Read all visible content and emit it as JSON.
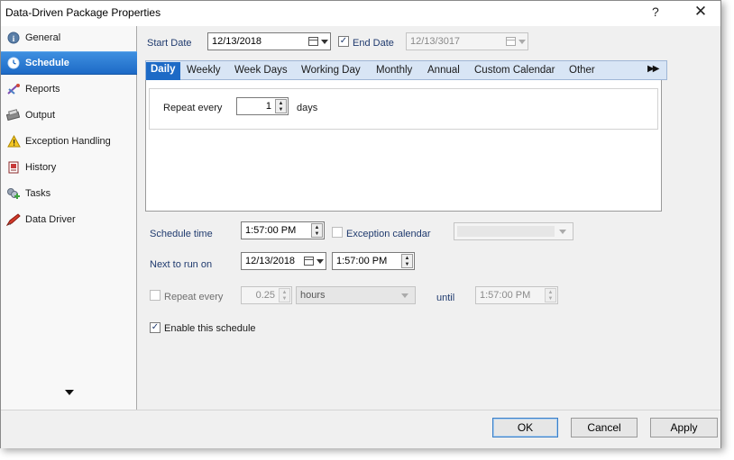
{
  "window": {
    "title": "Data-Driven Package Properties",
    "help_label": "?",
    "close_label": "✕"
  },
  "sidebar": {
    "items": [
      {
        "label": "General",
        "icon": "info-icon"
      },
      {
        "label": "Schedule",
        "icon": "clock-icon"
      },
      {
        "label": "Reports",
        "icon": "reports-icon"
      },
      {
        "label": "Output",
        "icon": "output-icon"
      },
      {
        "label": "Exception Handling",
        "icon": "warning-icon"
      },
      {
        "label": "History",
        "icon": "history-icon"
      },
      {
        "label": "Tasks",
        "icon": "tasks-icon"
      },
      {
        "label": "Data Driver",
        "icon": "data-driver-icon"
      }
    ],
    "active_index": 1
  },
  "schedule": {
    "start_date_label": "Start Date",
    "start_date": "12/13/2018",
    "end_date_label": "End Date",
    "end_date_checked": true,
    "end_date": "12/13/3017",
    "tabs": [
      "Daily",
      "Weekly",
      "Week Days",
      "Working Day",
      "Monthly",
      "Annual",
      "Custom Calendar",
      "Other"
    ],
    "active_tab": "Daily",
    "tab_scroll_label": "▶▶",
    "repeat_every_label": "Repeat every",
    "repeat_every_value": "1",
    "days_label": "days",
    "schedule_time_label": "Schedule time",
    "schedule_time": "1:57:00 PM",
    "exception_calendar_label": "Exception calendar",
    "exception_calendar_checked": false,
    "exception_calendar_value": "",
    "next_to_run_label": "Next to run on",
    "next_run_date": "12/13/2018",
    "next_run_time": "1:57:00 PM",
    "repeat_every2_label": "Repeat every",
    "repeat_every2_checked": false,
    "repeat_interval": "0.25",
    "repeat_unit": "hours",
    "until_label": "until",
    "until_time": "1:57:00 PM",
    "enable_label": "Enable this schedule",
    "enable_checked": true
  },
  "footer": {
    "ok_label": "OK",
    "cancel_label": "Cancel",
    "apply_label": "Apply"
  },
  "colors": {
    "accent": "#1d6ac6",
    "label_blue": "#1f3a6e",
    "tab_bar": "#d8e5f5"
  }
}
